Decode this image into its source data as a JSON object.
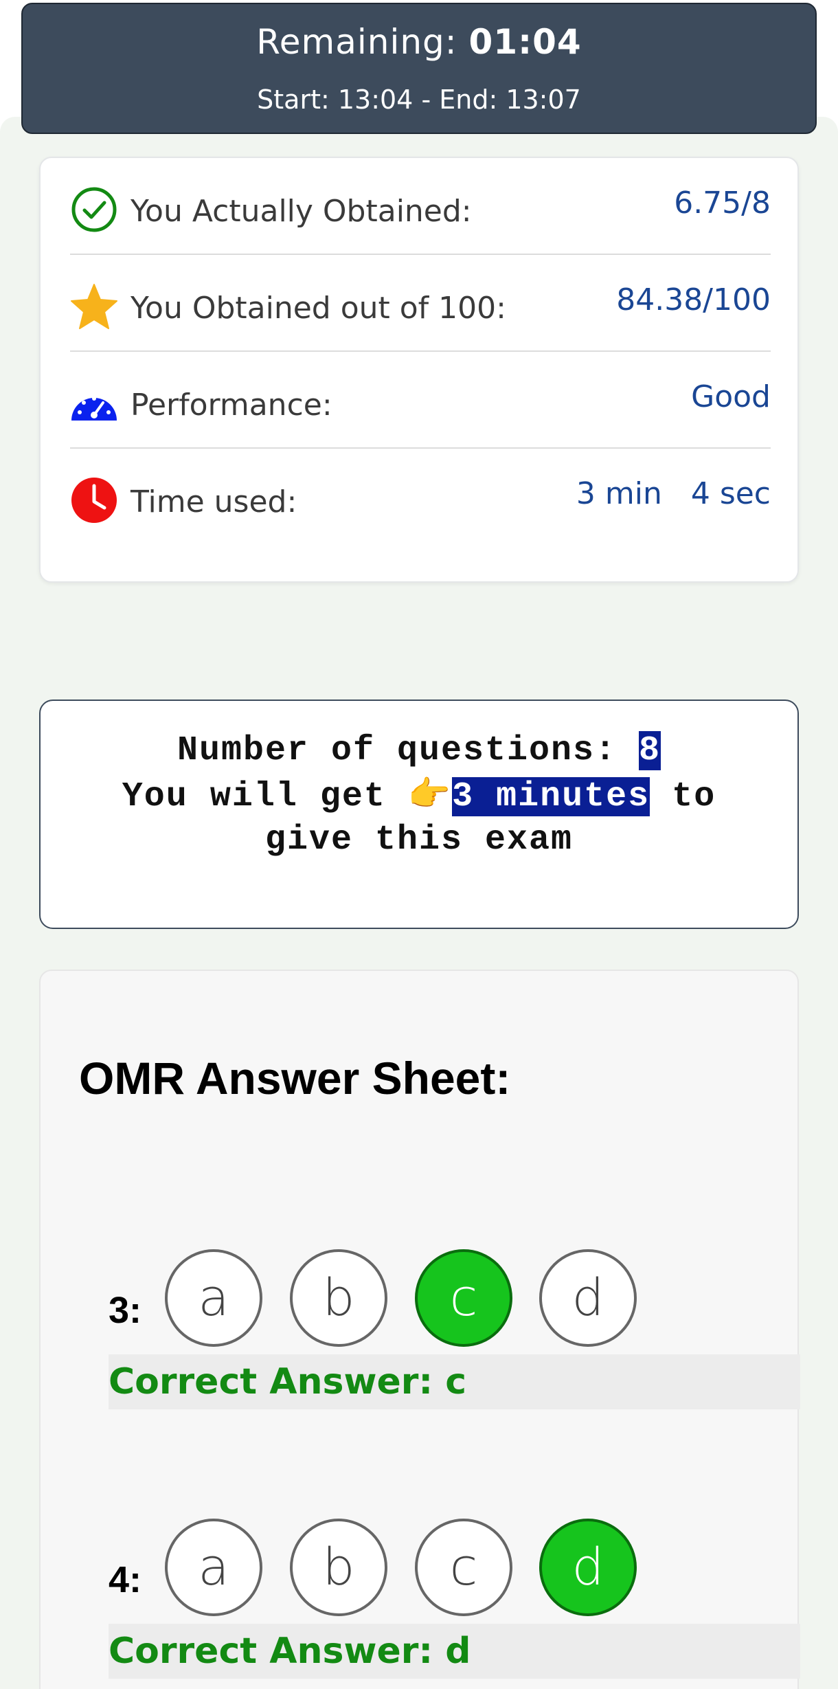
{
  "timer": {
    "remaining_label": "Remaining:",
    "remaining_value": "01:04",
    "range": "Start: 13:04 - End: 13:07"
  },
  "results": {
    "rows": [
      {
        "icon": "check-circle-icon",
        "label": "You Actually Obtained:",
        "value": "6.75/8"
      },
      {
        "icon": "star-icon",
        "label": "You Obtained out of 100:",
        "value": "84.38/100"
      },
      {
        "icon": "speedometer-icon",
        "label": "Performance:",
        "value": "Good"
      },
      {
        "icon": "clock-icon",
        "label": "Time used:",
        "value": "3 min   4 sec"
      }
    ]
  },
  "info": {
    "questions_label": "Number of questions: ",
    "questions_value": "8",
    "time_prefix": "You will get ",
    "time_emoji": "👉",
    "time_value": "3 minutes",
    "time_suffix": " to",
    "line3": "give this exam"
  },
  "omr": {
    "title": "OMR Answer Sheet:",
    "questions": [
      {
        "number": "3:",
        "options": [
          "a",
          "b",
          "c",
          "d"
        ],
        "selected": "c",
        "correct_label": "Correct Answer: c"
      },
      {
        "number": "4:",
        "options": [
          "a",
          "b",
          "c",
          "d"
        ],
        "selected": "d",
        "correct_label": "Correct Answer: d"
      }
    ]
  },
  "colors": {
    "header_bg": "#3d4b5c",
    "value_blue": "#1a4694",
    "highlight": "#0a1f94",
    "selected_green": "#16c41d",
    "answer_green": "#138a13"
  }
}
